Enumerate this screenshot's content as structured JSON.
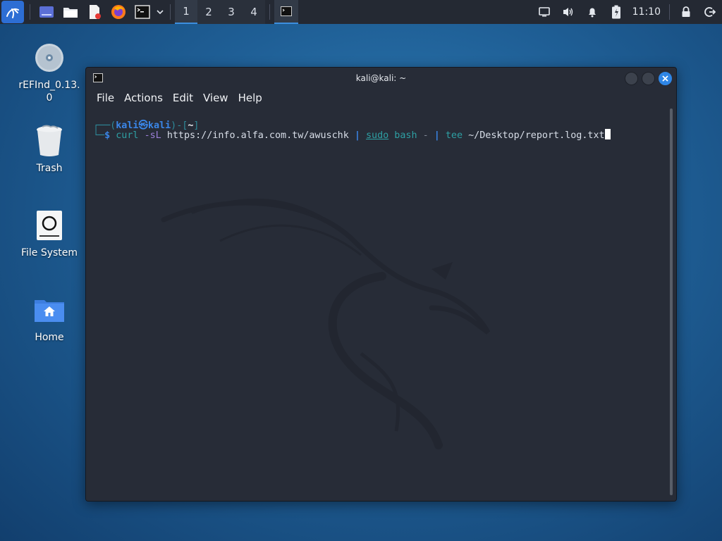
{
  "panel": {
    "workspaces": [
      "1",
      "2",
      "3",
      "4"
    ],
    "active_workspace": "1",
    "clock": "11:10"
  },
  "desktop": {
    "icons": [
      {
        "label": "rEFInd_0.13.0"
      },
      {
        "label": "Trash"
      },
      {
        "label": "File System"
      },
      {
        "label": "Home"
      }
    ]
  },
  "terminal": {
    "title": "kali@kali: ~",
    "menu": [
      "File",
      "Actions",
      "Edit",
      "View",
      "Help"
    ],
    "prompt": {
      "frame_top_left": "┌──(",
      "user": "kali",
      "at_symbol": "㉿",
      "host": "kali",
      "frame_mid": ")-[",
      "cwd": "~",
      "frame_close": "]",
      "frame_bottom": "└─",
      "dollar": "$"
    },
    "command": {
      "cmd": "curl",
      "flags": "-sL",
      "url": "https://info.alfa.com.tw/awuschk",
      "pipe1": "|",
      "sudo": "sudo",
      "bash": "bash",
      "dash": "-",
      "pipe2": "|",
      "tee": "tee",
      "path": "~/Desktop/report.log.txt"
    }
  },
  "colors": {
    "accent": "#3a86e8",
    "panel_bg": "#242933",
    "terminal_bg": "#272c37"
  }
}
